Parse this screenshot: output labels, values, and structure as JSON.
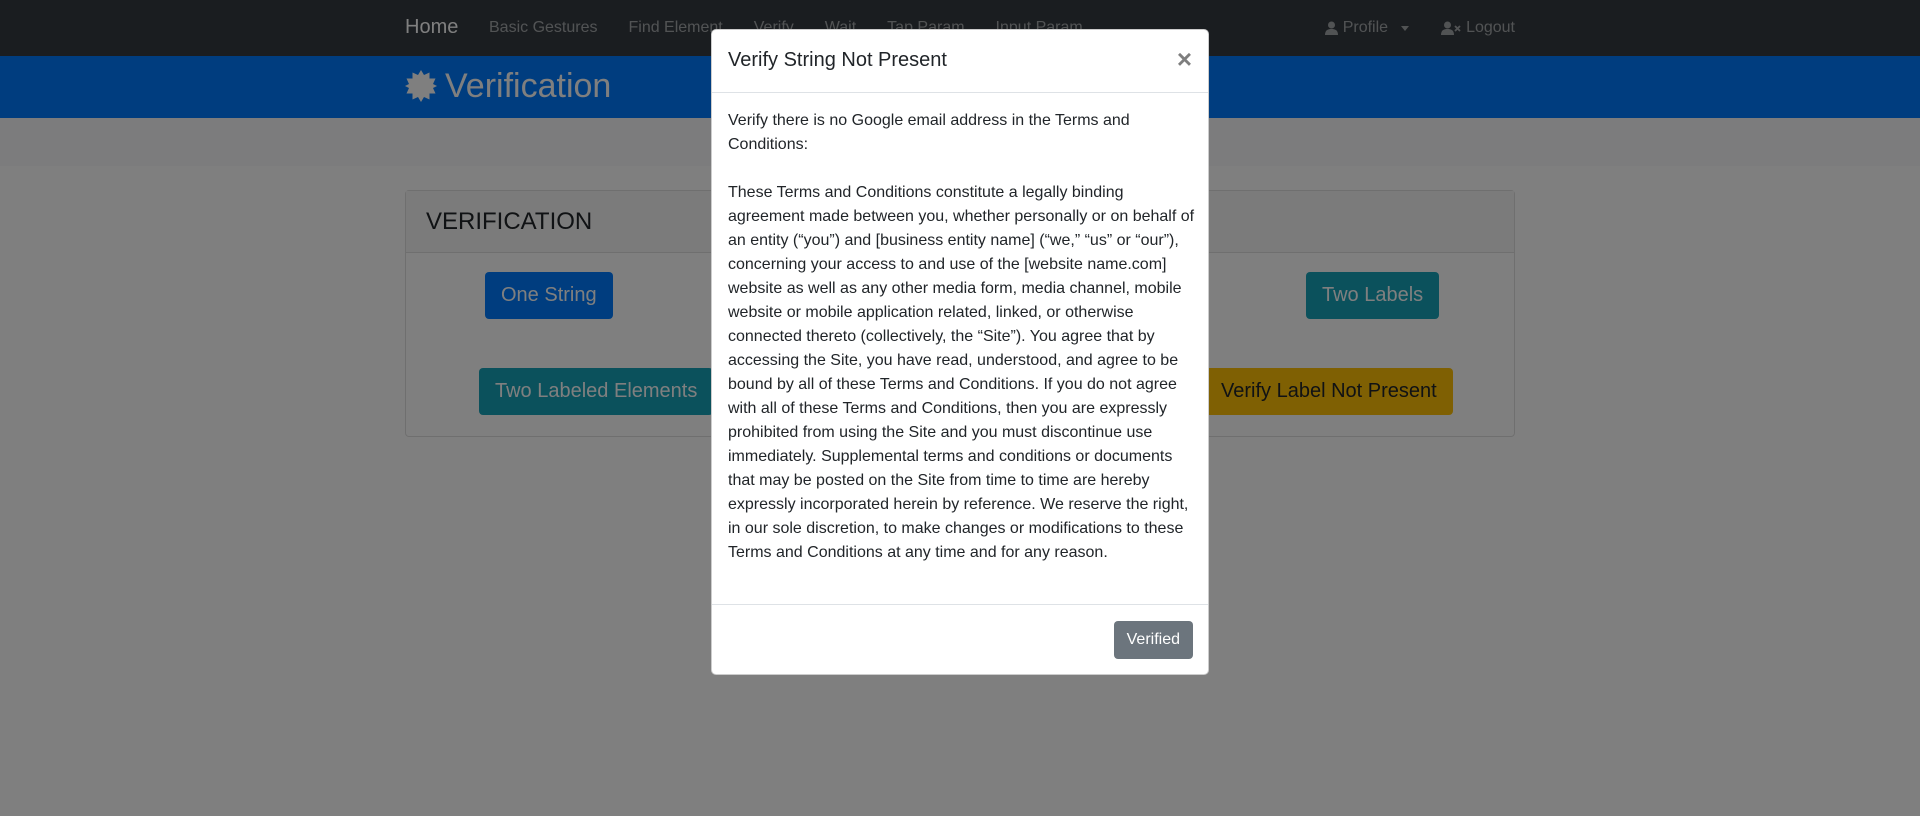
{
  "navbar": {
    "brand": "Home",
    "links": [
      "Basic Gestures",
      "Find Element",
      "Verify",
      "Wait",
      "Tap Param",
      "Input Param"
    ],
    "profile_label": "Profile",
    "logout_label": "Logout"
  },
  "banner": {
    "title": "Verification"
  },
  "card": {
    "title": "VERIFICATION",
    "buttons": {
      "one_string": "One String",
      "two_labels": "Two Labels",
      "two_labeled_elements": "Two Labeled Elements",
      "verify_label_not_present": "Verify Label Not Present"
    }
  },
  "modal": {
    "title": "Verify String Not Present",
    "close_label": "×",
    "intro": "Verify there is no Google email address in the Terms and Conditions:",
    "terms": "These Terms and Conditions constitute a legally binding agreement made between you, whether personally or on behalf of an entity (“you”) and [business entity name] (“we,” “us” or “our”), concerning your access to and use of the [website name.com] website as well as any other media form, media channel, mobile website or mobile application related, linked, or otherwise connected thereto (collectively, the “Site”). You agree that by accessing the Site, you have read, understood, and agree to be bound by all of these Terms and Conditions. If you do not agree with all of these Terms and Conditions, then you are expressly prohibited from using the Site and you must discontinue use immediately. Supplemental terms and conditions or documents that may be posted on the Site from time to time are hereby expressly incorporated herein by reference. We reserve the right, in our sole discretion, to make changes or modifications to these Terms and Conditions at any time and for any reason.",
    "verified_label": "Verified"
  },
  "colors": {
    "navbar": "#343a40",
    "banner": "#007bff",
    "primary": "#007bff",
    "info": "#17a2b8",
    "warning": "#ffc107",
    "secondary": "#6c757d"
  }
}
